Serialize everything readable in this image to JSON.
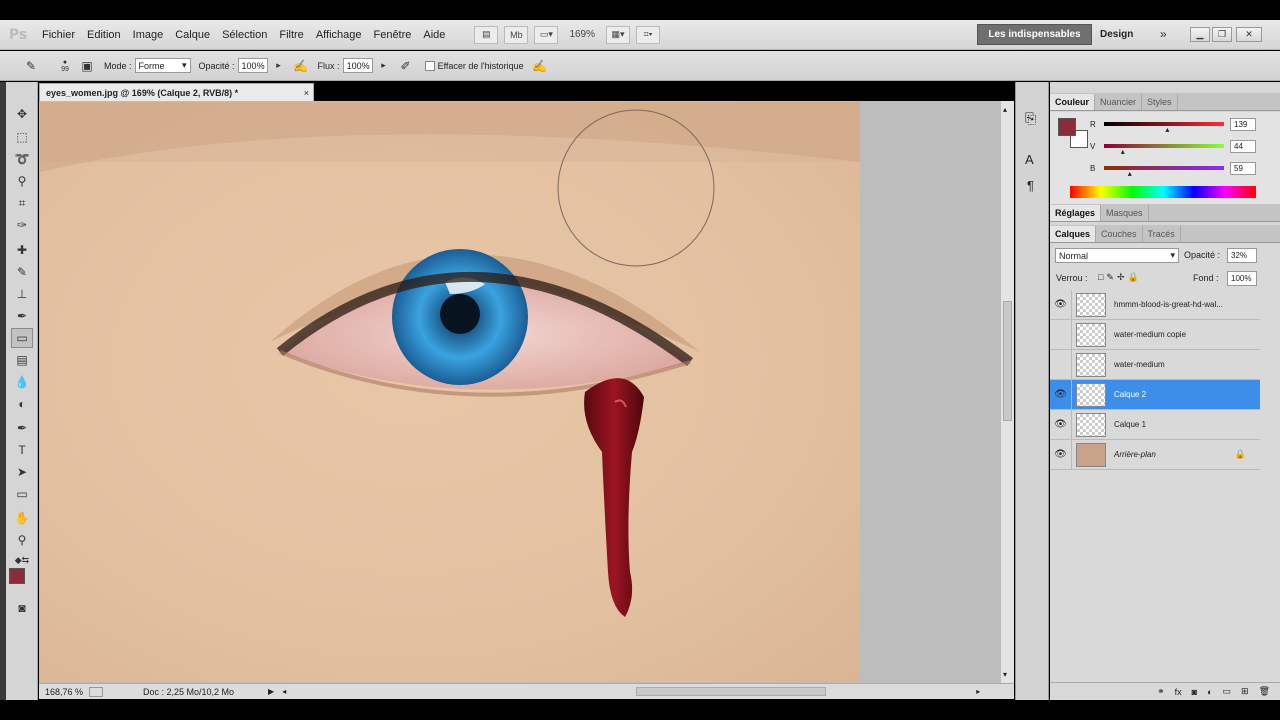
{
  "app": {
    "logo": "Ps"
  },
  "menu": [
    "Fichier",
    "Edition",
    "Image",
    "Calque",
    "Sélection",
    "Filtre",
    "Affichage",
    "Fenêtre",
    "Aide"
  ],
  "menubar": {
    "zoom": "169%",
    "workspace_active": "Les indispensables",
    "workspace_design": "Design",
    "more": "»"
  },
  "options": {
    "brush_size": "99",
    "mode_label": "Mode :",
    "mode_value": "Forme",
    "opacity_label": "Opacité :",
    "opacity_value": "100%",
    "flow_label": "Flux :",
    "flow_value": "100%",
    "history_label": "Effacer de l'historique"
  },
  "document": {
    "tab_title": "eyes_women.jpg @ 169% (Calque 2, RVB/8) *",
    "close": "×"
  },
  "status": {
    "zoom": "168,76 %",
    "doc": "Doc : 2,25 Mo/10,2 Mo"
  },
  "color_panel": {
    "tabs": [
      "Couleur",
      "Nuancier",
      "Styles"
    ],
    "foreground": "#8b2c3b",
    "r_label": "R",
    "r_value": "139",
    "r": 139,
    "v_label": "V",
    "v_value": "44",
    "v": 44,
    "b_label": "B",
    "b_value": "59",
    "b": 59
  },
  "adjust_panel": {
    "tabs": [
      "Réglages",
      "Masques"
    ]
  },
  "layers_panel": {
    "tabs": [
      "Calques",
      "Couches",
      "Tracés"
    ],
    "blend_mode": "Normal",
    "opacity_label": "Opacité :",
    "opacity_value": "32%",
    "lock_label": "Verrou :",
    "fill_label": "Fond :",
    "fill_value": "100%",
    "layers": [
      {
        "name": "hmmm-blood-is-great-hd-wal...",
        "visible": true,
        "selected": false
      },
      {
        "name": "water-medium copie",
        "visible": false,
        "selected": false
      },
      {
        "name": "water-medium",
        "visible": false,
        "selected": false
      },
      {
        "name": "Calque 2",
        "visible": true,
        "selected": true
      },
      {
        "name": "Calque 1",
        "visible": true,
        "selected": false
      },
      {
        "name": "Arrière-plan",
        "visible": true,
        "selected": false,
        "locked": true
      }
    ]
  },
  "colors": {
    "selection": "#3d8ee8",
    "foreground": "#8b2c3b",
    "blood": "#7a0a12",
    "iris": "#2f8fd4"
  }
}
